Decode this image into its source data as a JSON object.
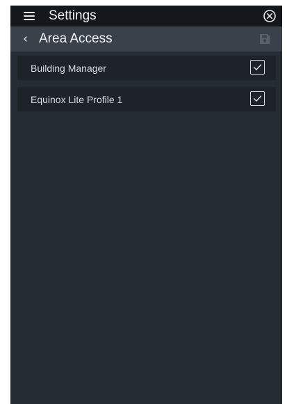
{
  "header": {
    "menu_icon": "hamburger-menu-icon",
    "title": "Settings",
    "close_icon": "close-circle-icon"
  },
  "subheader": {
    "back_icon": "chevron-left-icon",
    "title": "Area Access",
    "save_icon": "floppy-disk-save-icon"
  },
  "areas": [
    {
      "label": "Building Manager",
      "checked": true
    },
    {
      "label": "Equinox Lite Profile 1",
      "checked": true
    }
  ],
  "colors": {
    "header_bg": "#14171b",
    "subheader_bg": "#3a414a",
    "body_bg": "#262c34",
    "item_bg": "#1e232a",
    "text": "#eef0f2",
    "disabled_icon": "#5a616a"
  }
}
